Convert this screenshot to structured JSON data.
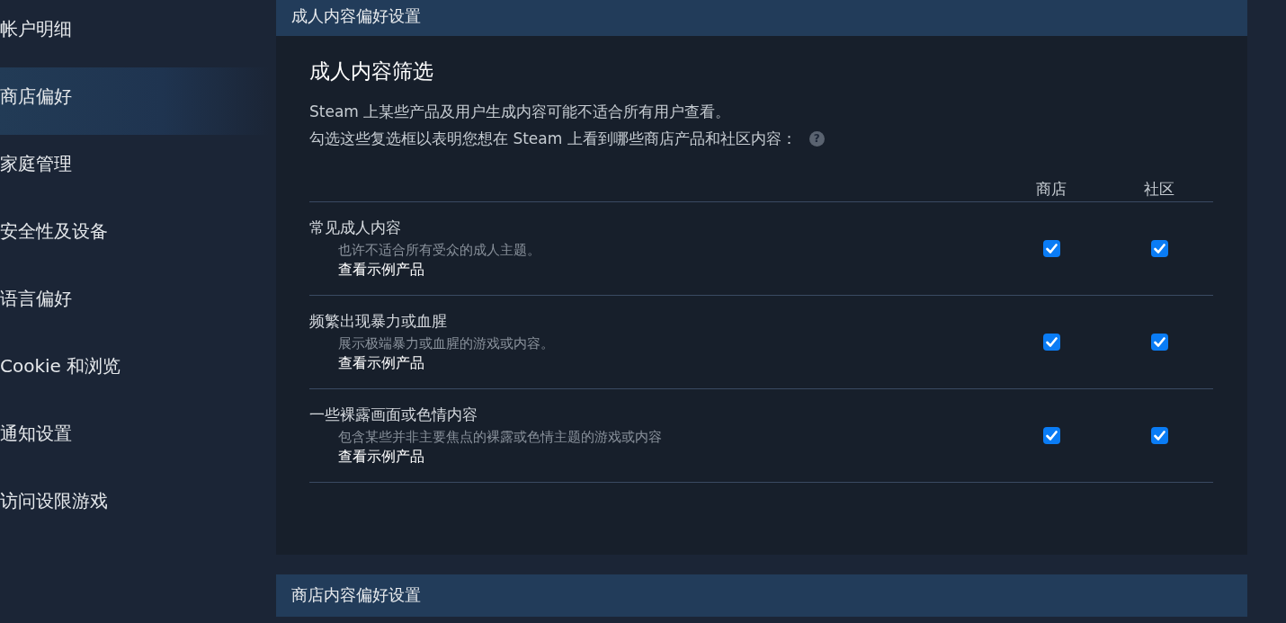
{
  "sidebar": {
    "items": [
      {
        "label": "帐户明细",
        "selected": false
      },
      {
        "label": "商店偏好",
        "selected": true
      },
      {
        "label": "家庭管理",
        "selected": false
      },
      {
        "label": "安全性及设备",
        "selected": false
      },
      {
        "label": "语言偏好",
        "selected": false
      },
      {
        "label": "Cookie 和浏览",
        "selected": false
      },
      {
        "label": "通知设置",
        "selected": false
      },
      {
        "label": "访问设限游戏",
        "selected": false
      }
    ]
  },
  "sections": [
    {
      "header": "成人内容偏好设置",
      "title": "成人内容筛选",
      "description": [
        "Steam 上某些产品及用户生成内容可能不适合所有用户查看。",
        "勾选这些复选框以表明您想在 Steam 上看到哪些商店产品和社区内容："
      ],
      "help_icon": "?",
      "columns": [
        "商店",
        "社区"
      ],
      "rows": [
        {
          "name": "常见成人内容",
          "detail": "也许不适合所有受众的成人主题。",
          "link": "查看示例产品",
          "store_checked": true,
          "community_checked": true
        },
        {
          "name": "频繁出现暴力或血腥",
          "detail": "展示极端暴力或血腥的游戏或内容。",
          "link": "查看示例产品",
          "store_checked": true,
          "community_checked": true
        },
        {
          "name": "一些裸露画面或色情内容",
          "detail": "包含某些并非主要焦点的裸露或色情主题的游戏或内容",
          "link": "查看示例产品",
          "store_checked": true,
          "community_checked": true
        }
      ]
    },
    {
      "header": "商店内容偏好设置"
    }
  ]
}
